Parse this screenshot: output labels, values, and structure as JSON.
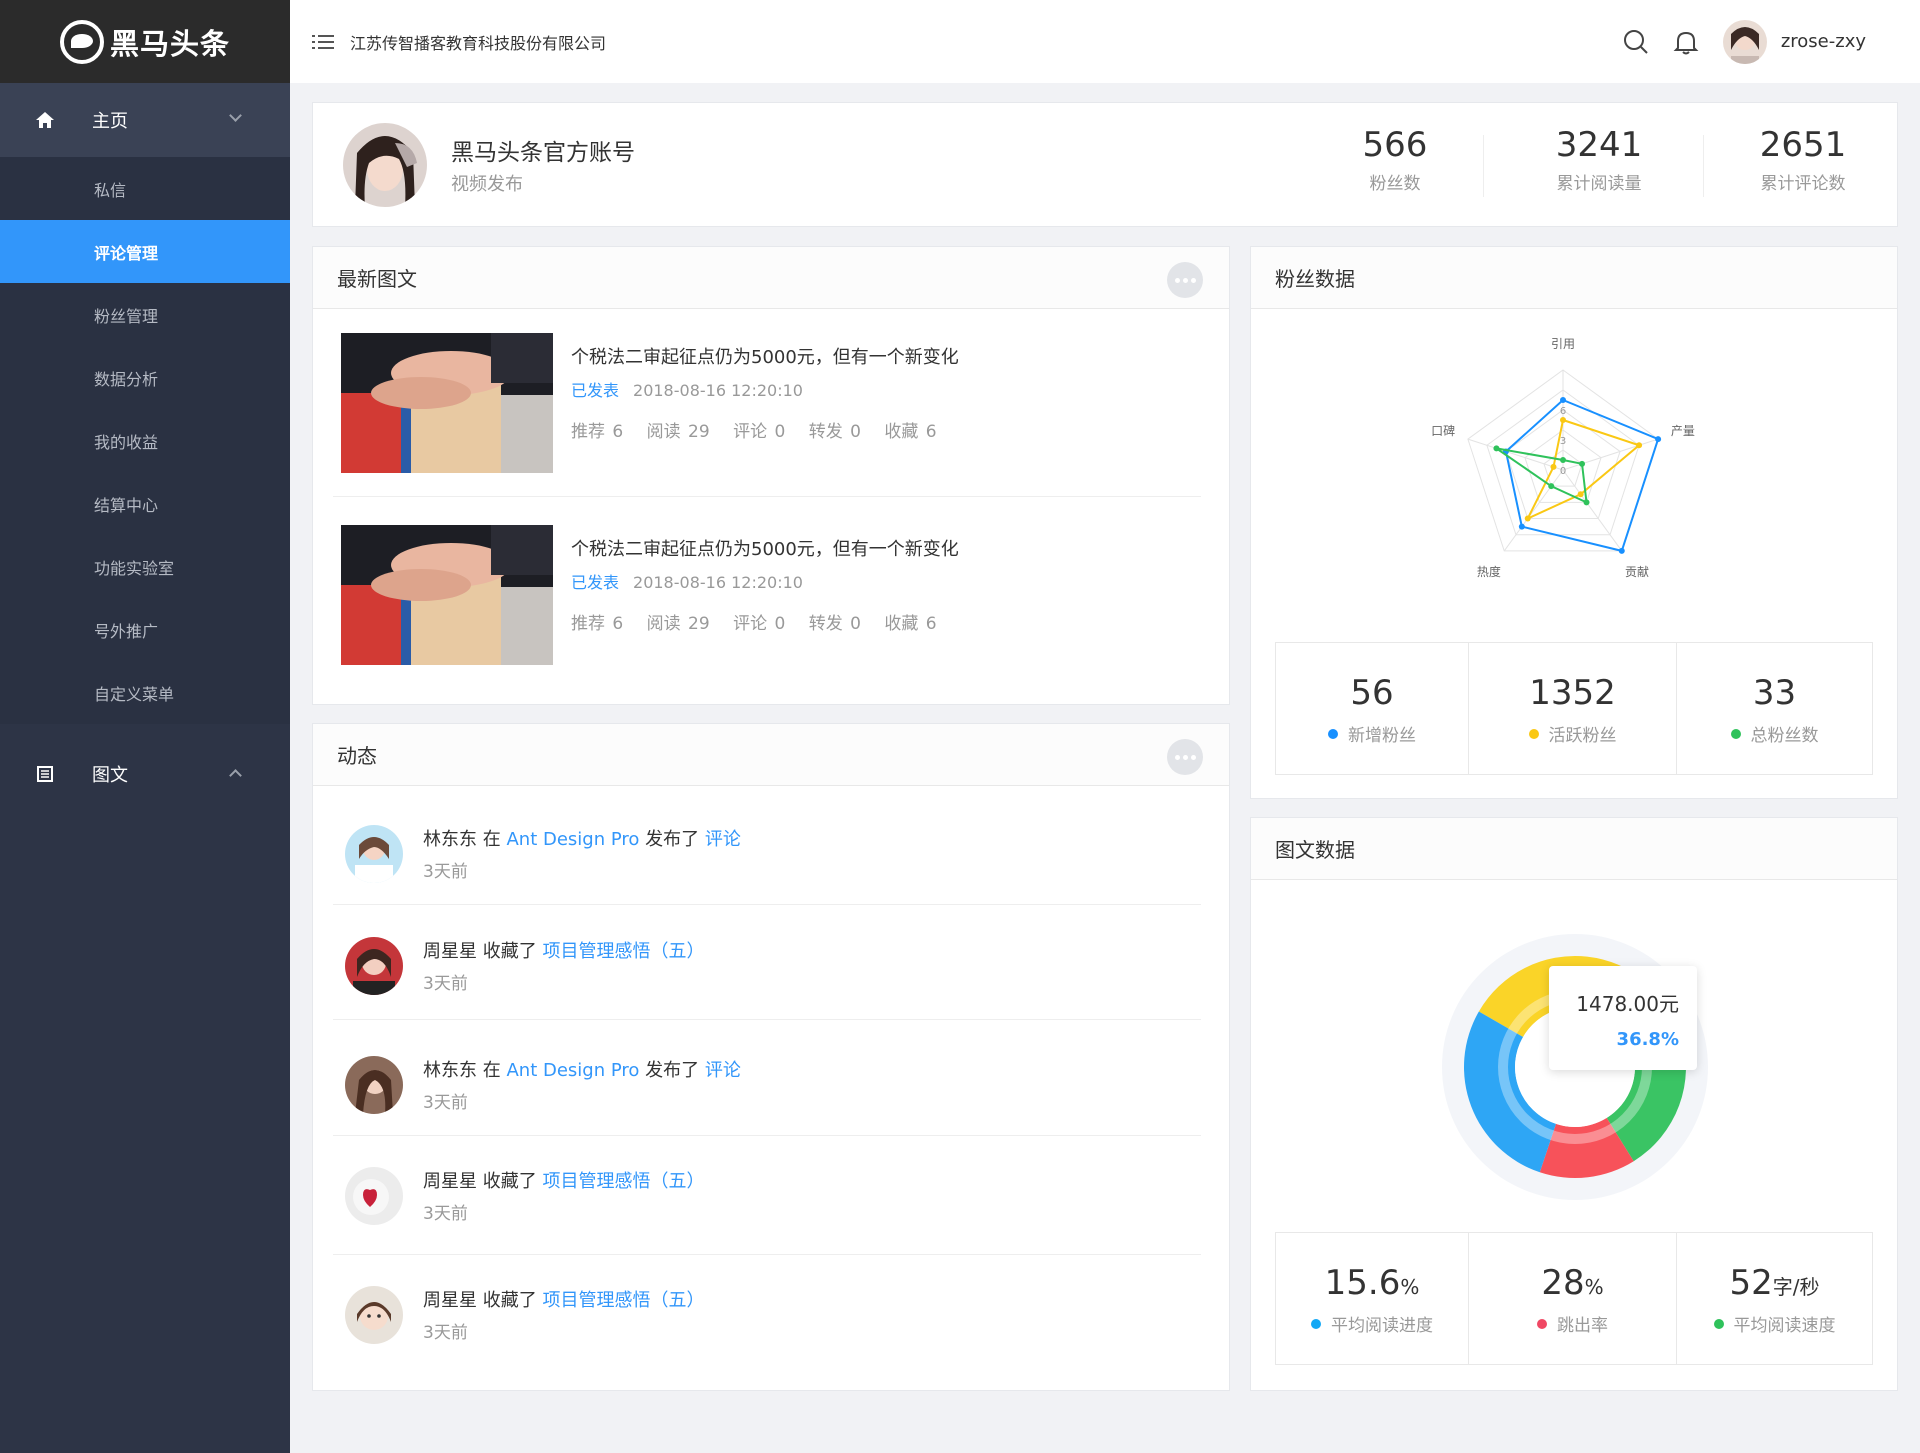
{
  "app": {
    "logo_text": "黑马头条",
    "company": "江苏传智播客教育科技股份有限公司",
    "username": "zrose-zxy"
  },
  "sidebar": {
    "home_label": "主页",
    "home_items": [
      "私信",
      "评论管理",
      "粉丝管理",
      "数据分析",
      "我的收益",
      "结算中心",
      "功能实验室",
      "号外推广",
      "自定义菜单"
    ],
    "active_item": "评论管理",
    "articles_label": "图文"
  },
  "profile": {
    "name": "黑马头条官方账号",
    "subtitle": "视频发布",
    "stats": [
      {
        "value": "566",
        "label": "粉丝数"
      },
      {
        "value": "3241",
        "label": "累计阅读量"
      },
      {
        "value": "2651",
        "label": "累计评论数"
      }
    ]
  },
  "latest": {
    "title": "最新图文",
    "articles": [
      {
        "title": "个税法二审起征点仍为5000元，但有一个新变化",
        "status": "已发表",
        "date": "2018-08-16 12:20:10",
        "stats": [
          "推荐 6",
          "阅读 29",
          "评论 0",
          "转发 0",
          "收藏 6"
        ]
      },
      {
        "title": "个税法二审起征点仍为5000元，但有一个新变化",
        "status": "已发表",
        "date": "2018-08-16 12:20:10",
        "stats": [
          "推荐 6",
          "阅读 29",
          "评论 0",
          "转发 0",
          "收藏 6"
        ]
      }
    ]
  },
  "activity": {
    "title": "动态",
    "items": [
      {
        "user": "林东东",
        "parts": [
          "在",
          "Ant Design Pro",
          "发布了",
          "评论"
        ],
        "time": "3天前"
      },
      {
        "user": "周星星",
        "parts": [
          "收藏了",
          "项目管理感悟（五）"
        ],
        "time": "3天前"
      },
      {
        "user": "林东东",
        "parts": [
          "在",
          "Ant Design Pro",
          "发布了",
          "评论"
        ],
        "time": "3天前"
      },
      {
        "user": "周星星",
        "parts": [
          "收藏了",
          "项目管理感悟（五）"
        ],
        "time": "3天前"
      },
      {
        "user": "周星星",
        "parts": [
          "收藏了",
          "项目管理感悟（五）"
        ],
        "time": "3天前"
      }
    ]
  },
  "fans": {
    "title": "粉丝数据",
    "stats": [
      {
        "value": "56",
        "label": "新增粉丝",
        "color": "#1890ff"
      },
      {
        "value": "1352",
        "label": "活跃粉丝",
        "color": "#fac814"
      },
      {
        "value": "33",
        "label": "总粉丝数",
        "color": "#2fc25b"
      }
    ]
  },
  "content": {
    "title": "图文数据",
    "stats": [
      {
        "value": "15.6",
        "unit": "%",
        "label": "平均阅读进度",
        "color": "#13a8f5"
      },
      {
        "value": "28",
        "unit": "%",
        "label": "跳出率",
        "color": "#f04864"
      },
      {
        "value": "52",
        "unit": "字/秒",
        "label": "平均阅读速度",
        "color": "#2fc25b"
      }
    ]
  },
  "chart_data": [
    {
      "type": "radar",
      "indicators": [
        "引用",
        "产量",
        "贡献",
        "热度",
        "口碑"
      ],
      "tick_labels": [
        "0",
        "3",
        "6"
      ],
      "max": 10,
      "series": [
        {
          "color": "#1890ff",
          "values": [
            7,
            10,
            10,
            7,
            6
          ]
        },
        {
          "color": "#fac814",
          "values": [
            5,
            8,
            3,
            6,
            1
          ]
        },
        {
          "color": "#2fc25b",
          "values": [
            1,
            2,
            4,
            2,
            7
          ]
        }
      ]
    },
    {
      "type": "pie",
      "slices": [
        {
          "value": 36.8,
          "color": "#fad428"
        },
        {
          "value": 21,
          "color": "#3ac464"
        },
        {
          "value": 14,
          "color": "#f7525a"
        },
        {
          "value": 28.2,
          "color": "#2ea6f5"
        }
      ],
      "tooltip": {
        "amount": "1478.00元",
        "percent": "36.8%"
      }
    }
  ]
}
